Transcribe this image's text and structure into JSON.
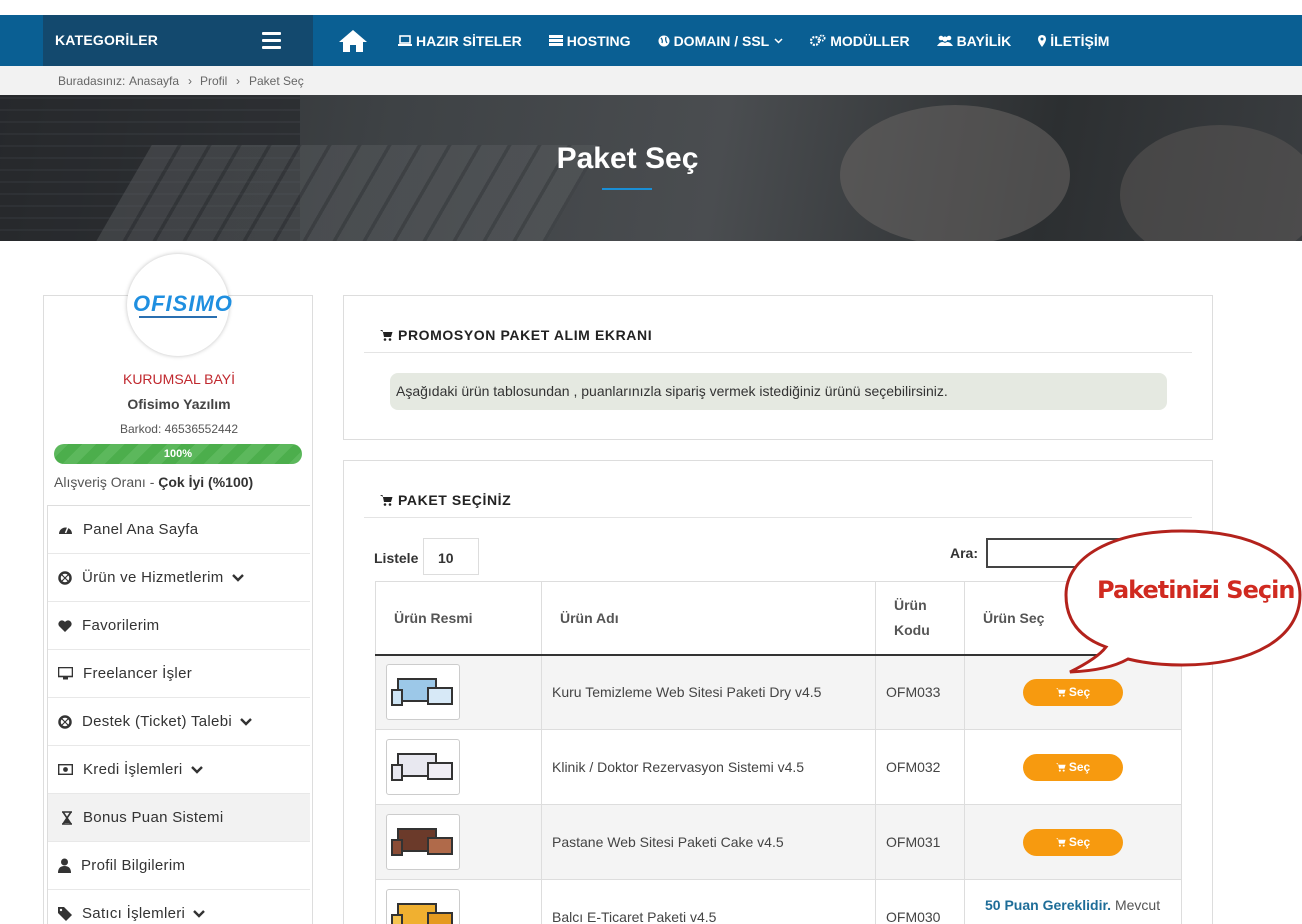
{
  "nav": {
    "categories_label": "KATEGORİLER",
    "items": [
      {
        "label": "HAZIR SİTELER",
        "icon": "laptop-icon"
      },
      {
        "label": "HOSTING",
        "icon": "server-icon"
      },
      {
        "label": "DOMAIN / SSL",
        "icon": "globe-icon",
        "has_dropdown": true
      },
      {
        "label": "MODÜLLER",
        "icon": "gears-icon"
      },
      {
        "label": "BAYİLİK",
        "icon": "users-icon"
      },
      {
        "label": "İLETİŞİM",
        "icon": "map-pin-icon"
      }
    ]
  },
  "breadcrumb": {
    "prefix": "Buradasınız:",
    "items": [
      "Anasayfa",
      "Profil",
      "Paket Seç"
    ]
  },
  "hero": {
    "title": "Paket Seç"
  },
  "profile": {
    "logo_text": "OFISIMO",
    "role": "KURUMSAL BAYİ",
    "company": "Ofisimo Yazılım",
    "barcode": "Barkod: 46536552442",
    "progress_label": "100%",
    "progress": 1.0,
    "rating_prefix": "Alışveriş Oranı -",
    "rating_value": "Çok İyi (%100)"
  },
  "menu": [
    {
      "label": "Panel Ana Sayfa",
      "icon": "dashboard-icon",
      "dropdown": false
    },
    {
      "label": "Ürün ve Hizmetlerim",
      "icon": "lifebuoy-icon",
      "dropdown": true
    },
    {
      "label": "Favorilerim",
      "icon": "heart-icon",
      "dropdown": false
    },
    {
      "label": "Freelancer İşler",
      "icon": "monitor-icon",
      "dropdown": false
    },
    {
      "label": "Destek (Ticket) Talebi",
      "icon": "lifebuoy-icon",
      "dropdown": true
    },
    {
      "label": "Kredi İşlemleri",
      "icon": "money-icon",
      "dropdown": true
    },
    {
      "label": "Bonus Puan Sistemi",
      "icon": "hourglass-icon",
      "dropdown": false,
      "active": true
    },
    {
      "label": "Profil Bilgilerim",
      "icon": "user-icon",
      "dropdown": false
    },
    {
      "label": "Satıcı İşlemleri",
      "icon": "tag-icon",
      "dropdown": true
    }
  ],
  "promo": {
    "title": "PROMOSYON PAKET ALIM EKRANI",
    "info": "Aşağıdaki ürün tablosundan , puanlarınızla sipariş vermek istediğiniz ürünü seçebilirsiniz."
  },
  "packages": {
    "title": "PAKET SEÇİNİZ",
    "list_label": "Listele",
    "page_size": "10",
    "search_label": "Ara:",
    "search_value": "",
    "columns": [
      "Ürün Resmi",
      "Ürün Adı",
      "Ürün Kodu",
      "Ürün Seç"
    ],
    "rows": [
      {
        "name": "Kuru Temizleme Web Sitesi Paketi Dry v4.5",
        "code": "OFM033",
        "action": "Seç"
      },
      {
        "name": "Klinik / Doktor Rezervasyon Sistemi v4.5",
        "code": "OFM032",
        "action": "Seç"
      },
      {
        "name": "Pastane Web Sitesi Paketi Cake v4.5",
        "code": "OFM031",
        "action": "Seç"
      },
      {
        "name": "Balcı E-Ticaret Paketi v4.5",
        "code": "OFM030",
        "need_bold": "50 Puan Gereklidir.",
        "need_rest": "Mevcut"
      }
    ]
  },
  "callout": {
    "text": "Paketinizi Seçin"
  },
  "colors": {
    "nav": "#0a5f93",
    "nav_dark": "#13496e",
    "button": "#f79a0f",
    "callout": "#d02a20",
    "progress": "#5cb85c"
  }
}
